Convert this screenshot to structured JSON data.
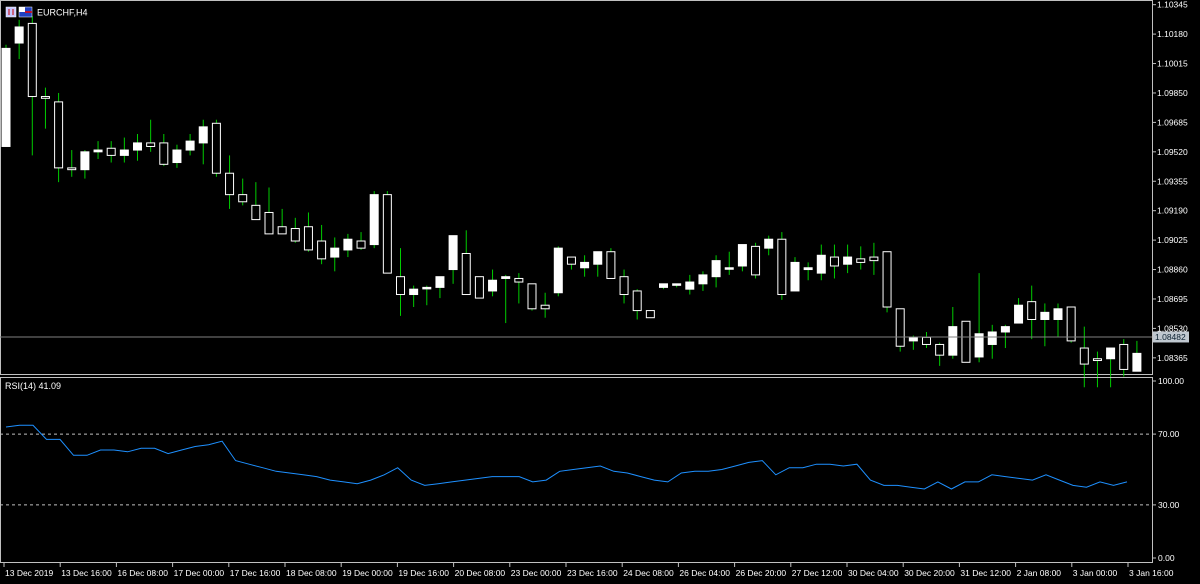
{
  "window": {
    "symbol_title": "EURCHF,H4",
    "icons": [
      "chart-window-icon-1",
      "chart-window-icon-2"
    ]
  },
  "colors": {
    "background": "#000000",
    "frame": "#c0c0c0",
    "bull_body": "#ffffff",
    "bear_body": "#000000",
    "candle_wick": "#00cc00",
    "bid_line": "#808080",
    "price_tag": "#c0c8d0",
    "rsi_line": "#1e90ff",
    "level_line": "#c0c0c0"
  },
  "chart_data": [
    {
      "type": "candlestick",
      "title": "EURCHF,H4",
      "current_price_label": "1.08482",
      "current_price": 1.08482,
      "ylim": [
        1.0828,
        1.1036
      ],
      "y_ticks": [
        "1.10345",
        "1.10180",
        "1.10015",
        "1.09850",
        "1.09685",
        "1.09520",
        "1.09355",
        "1.09190",
        "1.09025",
        "1.08860",
        "1.08695",
        "1.08530",
        "1.08365"
      ],
      "x_tick_labels": [
        "13 Dec 2019",
        "13 Dec 16:00",
        "16 Dec 08:00",
        "17 Dec 00:00",
        "17 Dec 16:00",
        "18 Dec 08:00",
        "19 Dec 00:00",
        "19 Dec 16:00",
        "20 Dec 08:00",
        "23 Dec 00:00",
        "23 Dec 16:00",
        "24 Dec 08:00",
        "26 Dec 04:00",
        "26 Dec 20:00",
        "27 Dec 12:00",
        "30 Dec 04:00",
        "30 Dec 20:00",
        "31 Dec 12:00",
        "2 Jan 08:00",
        "3 Jan 00:00",
        "3 Jan 16:00"
      ],
      "candles": [
        {
          "o": 1.0955,
          "h": 1.1012,
          "l": 1.0955,
          "c": 1.101
        },
        {
          "o": 1.1013,
          "h": 1.1026,
          "l": 1.1004,
          "c": 1.1022
        },
        {
          "o": 1.1024,
          "h": 1.1028,
          "l": 1.095,
          "c": 1.0983
        },
        {
          "o": 1.0983,
          "h": 1.0988,
          "l": 1.0965,
          "c": 1.0982
        },
        {
          "o": 1.098,
          "h": 1.0985,
          "l": 1.0935,
          "c": 1.0943
        },
        {
          "o": 1.0943,
          "h": 1.0953,
          "l": 1.0938,
          "c": 1.0942
        },
        {
          "o": 1.0942,
          "h": 1.0953,
          "l": 1.0937,
          "c": 1.0952
        },
        {
          "o": 1.0952,
          "h": 1.0958,
          "l": 1.0948,
          "c": 1.0953
        },
        {
          "o": 1.0954,
          "h": 1.0958,
          "l": 1.0946,
          "c": 1.095
        },
        {
          "o": 1.095,
          "h": 1.096,
          "l": 1.0946,
          "c": 1.0953
        },
        {
          "o": 1.0953,
          "h": 1.0962,
          "l": 1.0947,
          "c": 1.0957
        },
        {
          "o": 1.0957,
          "h": 1.097,
          "l": 1.0952,
          "c": 1.0955
        },
        {
          "o": 1.0957,
          "h": 1.0962,
          "l": 1.0944,
          "c": 1.0945
        },
        {
          "o": 1.0946,
          "h": 1.0956,
          "l": 1.0943,
          "c": 1.0953
        },
        {
          "o": 1.0953,
          "h": 1.0962,
          "l": 1.095,
          "c": 1.0958
        },
        {
          "o": 1.0957,
          "h": 1.097,
          "l": 1.0945,
          "c": 1.0966
        },
        {
          "o": 1.0968,
          "h": 1.097,
          "l": 1.0938,
          "c": 1.094
        },
        {
          "o": 1.094,
          "h": 1.095,
          "l": 1.092,
          "c": 1.0928
        },
        {
          "o": 1.0928,
          "h": 1.0937,
          "l": 1.0922,
          "c": 1.0924
        },
        {
          "o": 1.0922,
          "h": 1.0935,
          "l": 1.0918,
          "c": 1.0914
        },
        {
          "o": 1.0918,
          "h": 1.0932,
          "l": 1.0912,
          "c": 1.0906
        },
        {
          "o": 1.091,
          "h": 1.092,
          "l": 1.0907,
          "c": 1.0906
        },
        {
          "o": 1.0909,
          "h": 1.0915,
          "l": 1.0901,
          "c": 1.0902
        },
        {
          "o": 1.091,
          "h": 1.0918,
          "l": 1.0896,
          "c": 1.0897
        },
        {
          "o": 1.0902,
          "h": 1.0911,
          "l": 1.0889,
          "c": 1.0892
        },
        {
          "o": 1.0893,
          "h": 1.0904,
          "l": 1.0885,
          "c": 1.0898
        },
        {
          "o": 1.0897,
          "h": 1.0906,
          "l": 1.0893,
          "c": 1.0903
        },
        {
          "o": 1.0902,
          "h": 1.0907,
          "l": 1.0897,
          "c": 1.0898
        },
        {
          "o": 1.09,
          "h": 1.093,
          "l": 1.0898,
          "c": 1.0928
        },
        {
          "o": 1.0928,
          "h": 1.093,
          "l": 1.0884,
          "c": 1.0884
        },
        {
          "o": 1.0882,
          "h": 1.0898,
          "l": 1.086,
          "c": 1.0872
        },
        {
          "o": 1.0872,
          "h": 1.0877,
          "l": 1.0865,
          "c": 1.0875
        },
        {
          "o": 1.0876,
          "h": 1.0877,
          "l": 1.0866,
          "c": 1.0876
        },
        {
          "o": 1.0876,
          "h": 1.0881,
          "l": 1.087,
          "c": 1.0882
        },
        {
          "o": 1.0886,
          "h": 1.0905,
          "l": 1.0878,
          "c": 1.0905
        },
        {
          "o": 1.0895,
          "h": 1.0908,
          "l": 1.0872,
          "c": 1.0872
        },
        {
          "o": 1.0882,
          "h": 1.0882,
          "l": 1.0872,
          "c": 1.087
        },
        {
          "o": 1.0874,
          "h": 1.0886,
          "l": 1.0871,
          "c": 1.088
        },
        {
          "o": 1.0881,
          "h": 1.0883,
          "l": 1.0856,
          "c": 1.0882
        },
        {
          "o": 1.0881,
          "h": 1.0884,
          "l": 1.0867,
          "c": 1.0879
        },
        {
          "o": 1.0878,
          "h": 1.0878,
          "l": 1.0863,
          "c": 1.0864
        },
        {
          "o": 1.0866,
          "h": 1.0873,
          "l": 1.0859,
          "c": 1.0864
        },
        {
          "o": 1.0873,
          "h": 1.0899,
          "l": 1.0871,
          "c": 1.0898
        },
        {
          "o": 1.0893,
          "h": 1.0893,
          "l": 1.0886,
          "c": 1.0889
        },
        {
          "o": 1.0887,
          "h": 1.0894,
          "l": 1.0882,
          "c": 1.089
        },
        {
          "o": 1.0889,
          "h": 1.0896,
          "l": 1.0882,
          "c": 1.0896
        },
        {
          "o": 1.0896,
          "h": 1.0898,
          "l": 1.0881,
          "c": 1.0881
        },
        {
          "o": 1.0882,
          "h": 1.0886,
          "l": 1.0867,
          "c": 1.0872
        },
        {
          "o": 1.0874,
          "h": 1.0875,
          "l": 1.0858,
          "c": 1.0863
        },
        {
          "o": 1.0863,
          "h": 1.0863,
          "l": 1.086,
          "c": 1.0859
        },
        {
          "o": 1.0876,
          "h": 1.0878,
          "l": 1.0875,
          "c": 1.0878
        },
        {
          "o": 1.0878,
          "h": 1.0878,
          "l": 1.0876,
          "c": 1.0878
        },
        {
          "o": 1.0875,
          "h": 1.0883,
          "l": 1.0872,
          "c": 1.0879
        },
        {
          "o": 1.0878,
          "h": 1.0885,
          "l": 1.0874,
          "c": 1.0883
        },
        {
          "o": 1.0882,
          "h": 1.0894,
          "l": 1.0876,
          "c": 1.0891
        },
        {
          "o": 1.0887,
          "h": 1.0896,
          "l": 1.0883,
          "c": 1.0887
        },
        {
          "o": 1.0888,
          "h": 1.0898,
          "l": 1.0885,
          "c": 1.09
        },
        {
          "o": 1.0899,
          "h": 1.0901,
          "l": 1.0881,
          "c": 1.0883
        },
        {
          "o": 1.0898,
          "h": 1.0905,
          "l": 1.0894,
          "c": 1.0903
        },
        {
          "o": 1.0903,
          "h": 1.0907,
          "l": 1.0869,
          "c": 1.0872
        },
        {
          "o": 1.0874,
          "h": 1.0893,
          "l": 1.0874,
          "c": 1.089
        },
        {
          "o": 1.0886,
          "h": 1.089,
          "l": 1.088,
          "c": 1.0887
        },
        {
          "o": 1.0884,
          "h": 1.09,
          "l": 1.088,
          "c": 1.0894
        },
        {
          "o": 1.0893,
          "h": 1.09,
          "l": 1.0881,
          "c": 1.0888
        },
        {
          "o": 1.0889,
          "h": 1.09,
          "l": 1.0884,
          "c": 1.0893
        },
        {
          "o": 1.0892,
          "h": 1.0899,
          "l": 1.0886,
          "c": 1.089
        },
        {
          "o": 1.0893,
          "h": 1.0901,
          "l": 1.0883,
          "c": 1.0891
        },
        {
          "o": 1.0896,
          "h": 1.0896,
          "l": 1.0862,
          "c": 1.0865
        },
        {
          "o": 1.0864,
          "h": 1.0864,
          "l": 1.084,
          "c": 1.0843
        },
        {
          "o": 1.0846,
          "h": 1.0849,
          "l": 1.0841,
          "c": 1.0848
        },
        {
          "o": 1.0848,
          "h": 1.0851,
          "l": 1.0842,
          "c": 1.0844
        },
        {
          "o": 1.0844,
          "h": 1.0845,
          "l": 1.0832,
          "c": 1.0838
        },
        {
          "o": 1.0838,
          "h": 1.0865,
          "l": 1.0836,
          "c": 1.0854
        },
        {
          "o": 1.0857,
          "h": 1.0857,
          "l": 1.0834,
          "c": 1.0834
        },
        {
          "o": 1.0837,
          "h": 1.0884,
          "l": 1.0834,
          "c": 1.085
        },
        {
          "o": 1.0844,
          "h": 1.0855,
          "l": 1.0836,
          "c": 1.0851
        },
        {
          "o": 1.0851,
          "h": 1.0855,
          "l": 1.0842,
          "c": 1.0854
        },
        {
          "o": 1.0856,
          "h": 1.087,
          "l": 1.0856,
          "c": 1.0866
        },
        {
          "o": 1.0868,
          "h": 1.0877,
          "l": 1.0847,
          "c": 1.0858
        },
        {
          "o": 1.0858,
          "h": 1.0867,
          "l": 1.0843,
          "c": 1.0862
        },
        {
          "o": 1.0858,
          "h": 1.0867,
          "l": 1.0848,
          "c": 1.0864
        },
        {
          "o": 1.0865,
          "h": 1.0865,
          "l": 1.0845,
          "c": 1.0846
        },
        {
          "o": 1.0842,
          "h": 1.0854,
          "l": 1.082,
          "c": 1.0833
        },
        {
          "o": 1.0836,
          "h": 1.084,
          "l": 1.082,
          "c": 1.0835
        },
        {
          "o": 1.0836,
          "h": 1.0841,
          "l": 1.082,
          "c": 1.0842
        },
        {
          "o": 1.0844,
          "h": 1.0847,
          "l": 1.0826,
          "c": 1.083
        },
        {
          "o": 1.0829,
          "h": 1.0846,
          "l": 1.0829,
          "c": 1.0839
        }
      ]
    },
    {
      "type": "line",
      "title": "RSI(14) 41.09",
      "ylim": [
        0,
        100
      ],
      "y_ticks": [
        "100.00",
        "70.00",
        "30.00",
        "0.00"
      ],
      "levels": [
        70,
        30
      ],
      "series": [
        {
          "values": [
            74,
            75,
            75,
            67,
            67,
            58,
            58,
            61,
            61,
            60,
            62,
            62,
            59,
            61,
            63,
            64,
            66,
            55,
            53,
            51,
            49,
            48,
            47,
            46,
            44,
            43,
            42,
            44,
            47,
            51,
            44,
            41,
            42,
            43,
            44,
            45,
            46,
            46,
            46,
            43,
            44,
            49,
            50,
            51,
            52,
            49,
            48,
            46,
            44,
            43,
            48,
            49,
            49,
            50,
            52,
            54,
            55,
            47,
            51,
            51,
            53,
            53,
            52,
            53,
            44,
            41,
            41,
            40,
            39,
            43,
            39,
            43,
            43,
            47,
            46,
            45,
            44,
            47,
            44,
            41,
            40,
            43,
            41,
            43
          ]
        }
      ]
    }
  ]
}
